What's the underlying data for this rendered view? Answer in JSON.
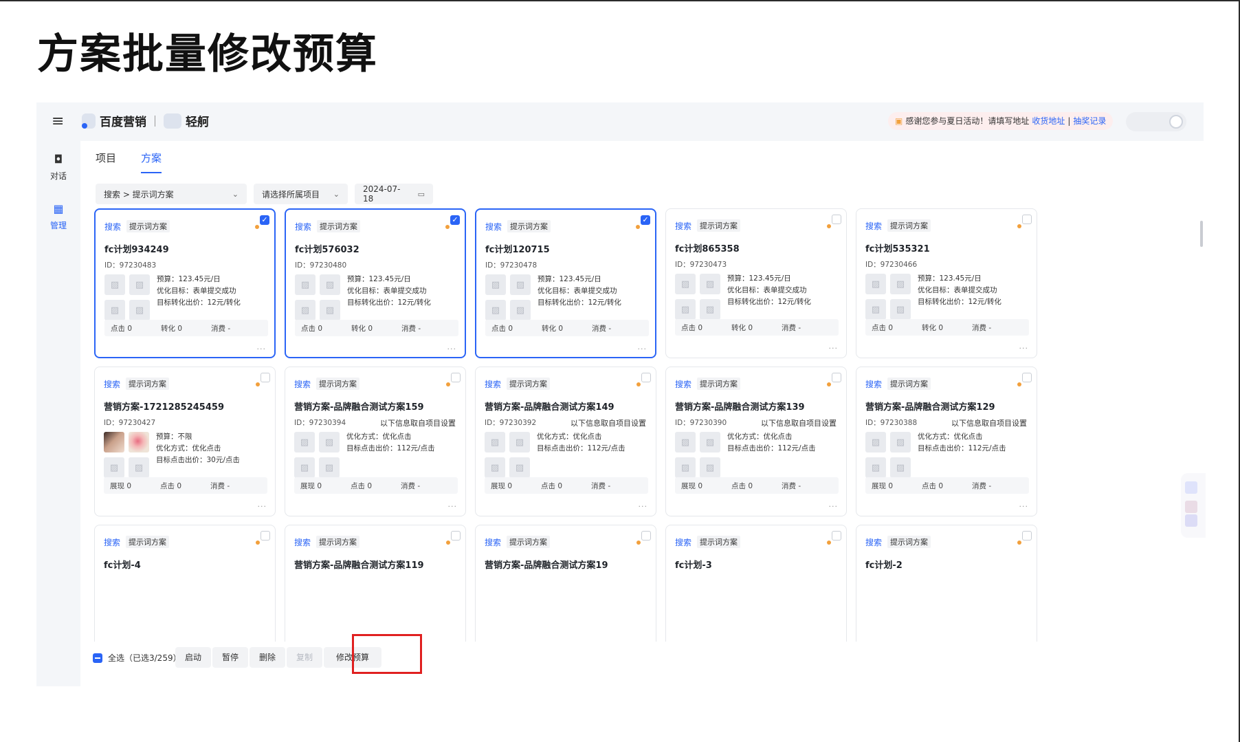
{
  "slide": {
    "title": "方案批量修改预算"
  },
  "app": {
    "brand_main": "百度营销",
    "brand_sub": "轻舸",
    "notice": {
      "text": "感谢您参与夏日活动！请填写地址",
      "link1": "收货地址",
      "sep": "|",
      "link2": "抽奖记录"
    }
  },
  "sidebar": {
    "items": [
      {
        "label": "对话",
        "icon": "chat-icon"
      },
      {
        "label": "管理",
        "icon": "grid-icon"
      }
    ]
  },
  "tabs": [
    {
      "label": "项目"
    },
    {
      "label": "方案"
    }
  ],
  "filters": {
    "scheme_type": "搜索 > 提示词方案",
    "project": "请选择所属项目",
    "date": "2024-07-18"
  },
  "card_labels": {
    "search_tag": "搜索",
    "type_tag": "提示词方案",
    "budget": "预算：",
    "goal": "优化目标：",
    "target_conv_bid": "目标转化出价：",
    "opt_method": "优化方式：",
    "target_click_bid": "目标点击出价：",
    "source_note": "以下信息取自项目设置",
    "impressions": "展现 0",
    "clicks": "点击 0",
    "conversions": "转化 0",
    "cost": "消费 -",
    "more": "···"
  },
  "cards_row1": [
    {
      "name": "fc计划934249",
      "id": "ID：97230483",
      "selected": true
    },
    {
      "name": "fc计划576032",
      "id": "ID：97230480",
      "selected": true
    },
    {
      "name": "fc计划120715",
      "id": "ID：97230478",
      "selected": true
    },
    {
      "name": "fc计划865358",
      "id": "ID：97230473",
      "selected": false
    },
    {
      "name": "fc计划535321",
      "id": "ID：97230466",
      "selected": false
    }
  ],
  "row1_meta": {
    "budget": "预算：123.45元/日",
    "goal": "优化目标：表单提交成功",
    "bid": "目标转化出价：12元/转化"
  },
  "cards_row2": [
    {
      "name": "营销方案-1721285245459",
      "id": "ID：97230427",
      "meta1": "预算：不限",
      "meta2": "优化方式：优化点击",
      "meta3": "目标点击出价：30元/点击"
    },
    {
      "name": "营销方案-品牌融合测试方案159",
      "id": "ID：97230394",
      "meta1": "优化方式：优化点击",
      "meta2": "目标点击出价：112元/点击"
    },
    {
      "name": "营销方案-品牌融合测试方案149",
      "id": "ID：97230392",
      "meta1": "优化方式：优化点击",
      "meta2": "目标点击出价：112元/点击"
    },
    {
      "name": "营销方案-品牌融合测试方案139",
      "id": "ID：97230390",
      "meta1": "优化方式：优化点击",
      "meta2": "目标点击出价：112元/点击"
    },
    {
      "name": "营销方案-品牌融合测试方案129",
      "id": "ID：97230388",
      "meta1": "优化方式：优化点击",
      "meta2": "目标点击出价：112元/点击"
    }
  ],
  "cards_row3": [
    {
      "name": "fc计划-4"
    },
    {
      "name": "营销方案-品牌融合测试方案119"
    },
    {
      "name": "营销方案-品牌融合测试方案19"
    },
    {
      "name": "fc计划-3"
    },
    {
      "name": "fc计划-2"
    }
  ],
  "bottom_bar": {
    "select_all": "全选（已选3/259）",
    "enable": "启动",
    "pause": "暂停",
    "delete": "删除",
    "copy": "复制",
    "edit_budget": "修改预算"
  },
  "colors": {
    "accent": "#2a64f6",
    "status_dot": "#f2a03c",
    "highlight": "#e02020"
  }
}
